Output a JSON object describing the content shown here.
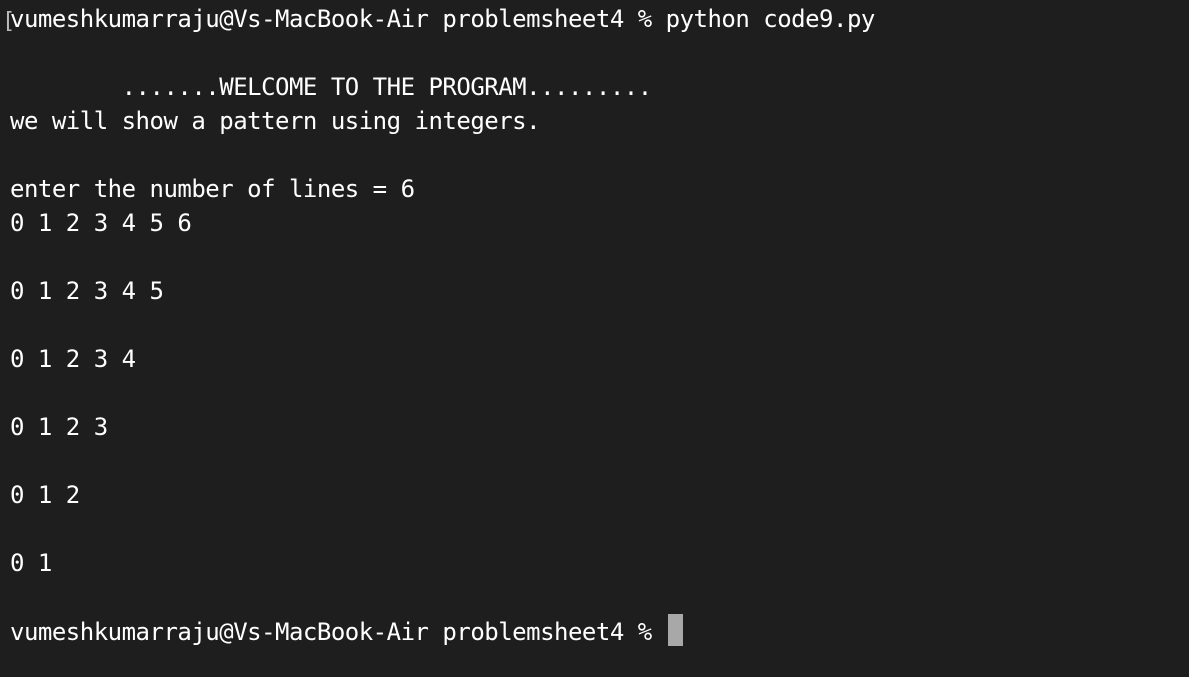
{
  "terminal": {
    "mark": "[",
    "lines": [
      "vumeshkumarraju@Vs-MacBook-Air problemsheet4 % python code9.py",
      "",
      "        .......WELCOME TO THE PROGRAM.........",
      "we will show a pattern using integers.",
      "",
      "enter the number of lines = 6",
      "0 1 2 3 4 5 6",
      "",
      "0 1 2 3 4 5",
      "",
      "0 1 2 3 4",
      "",
      "0 1 2 3",
      "",
      "0 1 2",
      "",
      "0 1",
      "",
      "vumeshkumarraju@Vs-MacBook-Air problemsheet4 % "
    ],
    "cursor_color": "#a8a8a8",
    "background": "#1e1e1e",
    "foreground": "#ffffff"
  }
}
